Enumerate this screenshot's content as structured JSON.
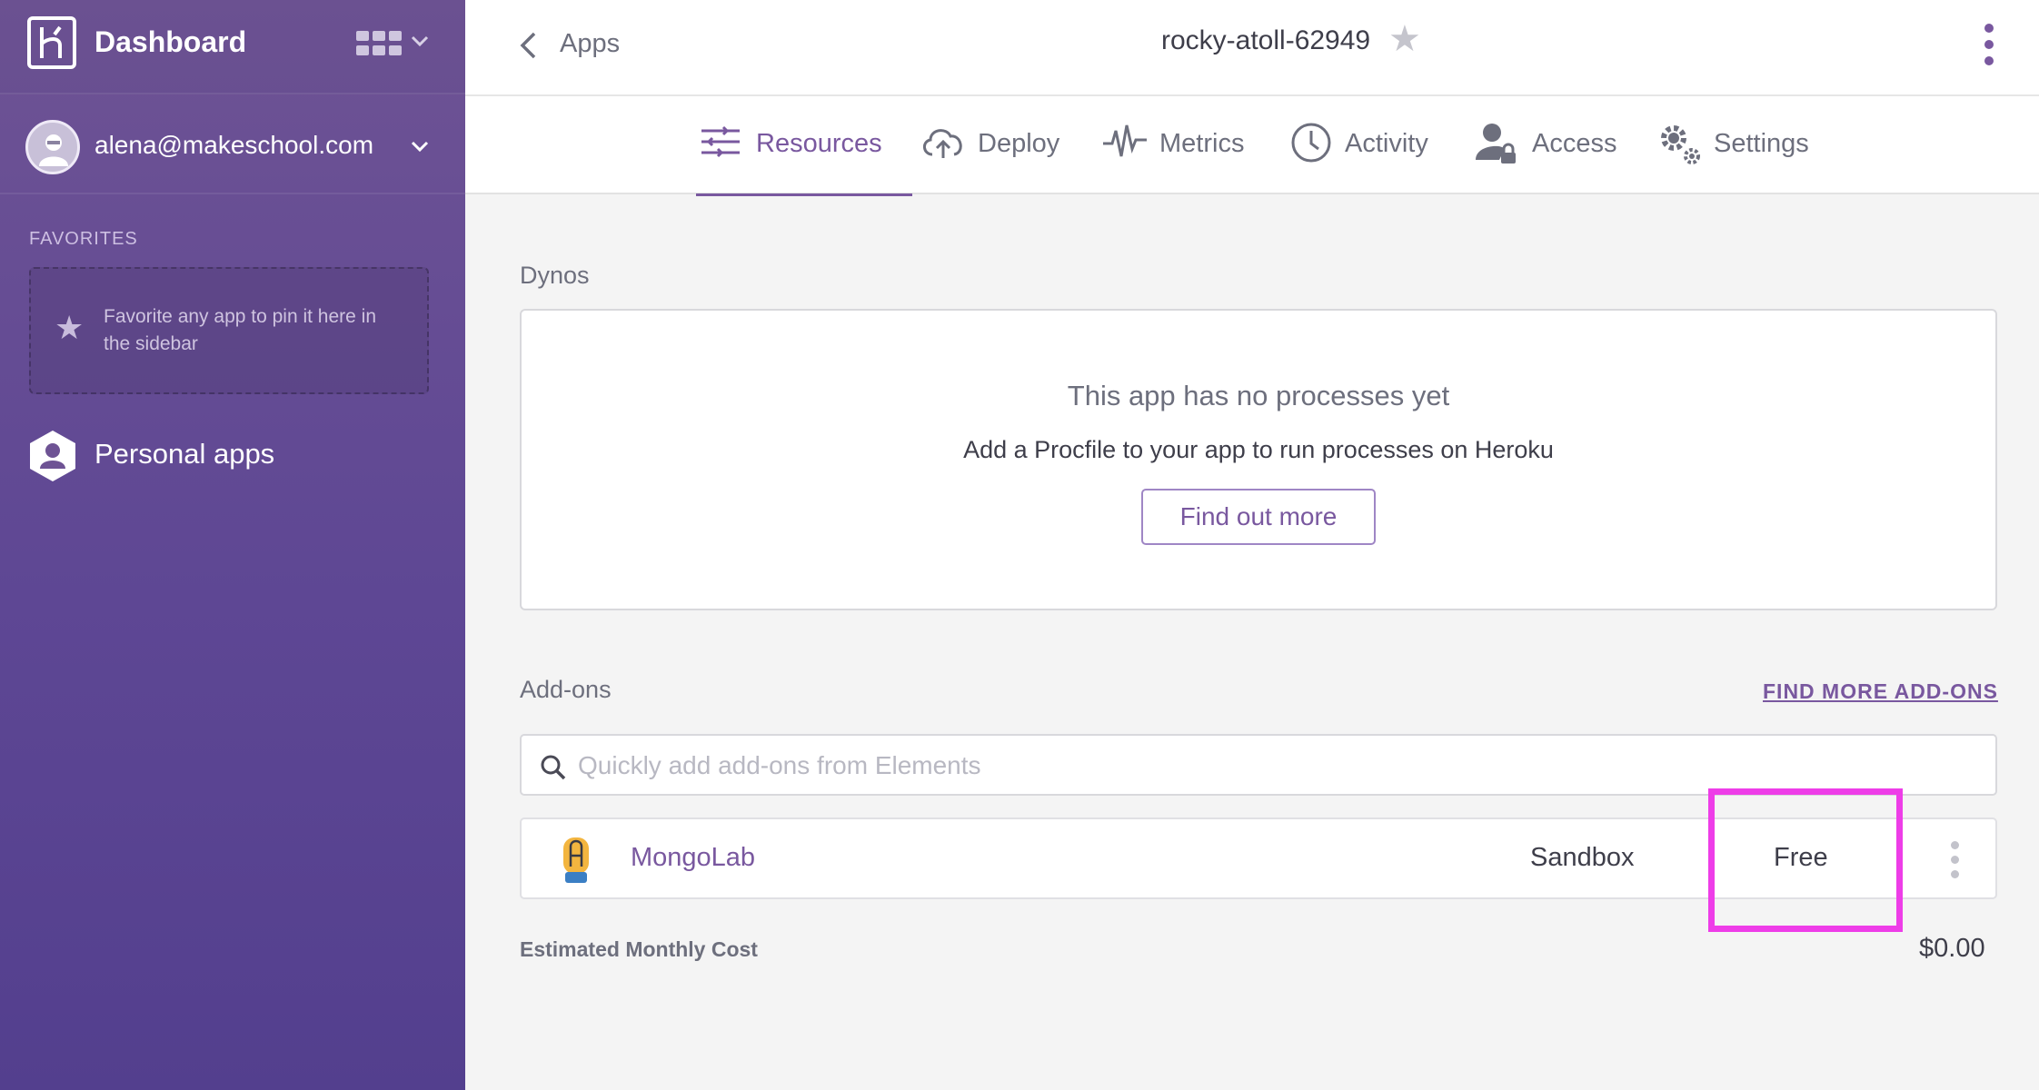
{
  "sidebar": {
    "title": "Dashboard",
    "account_email": "alena@makeschool.com",
    "favorites_label": "FAVORITES",
    "favorites_hint": "Favorite any app to pin it here in the sidebar",
    "personal_apps_label": "Personal apps"
  },
  "header": {
    "back_label": "Apps",
    "app_name": "rocky-atoll-62949"
  },
  "tabs": [
    {
      "label": "Resources",
      "icon": "resources-icon",
      "active": true
    },
    {
      "label": "Deploy",
      "icon": "cloud-upload-icon",
      "active": false
    },
    {
      "label": "Metrics",
      "icon": "pulse-icon",
      "active": false
    },
    {
      "label": "Activity",
      "icon": "clock-icon",
      "active": false
    },
    {
      "label": "Access",
      "icon": "user-lock-icon",
      "active": false
    },
    {
      "label": "Settings",
      "icon": "gears-icon",
      "active": false
    }
  ],
  "dynos": {
    "section_title": "Dynos",
    "empty_heading": "This app has no processes yet",
    "empty_text": "Add a Procfile to your app to run processes on Heroku",
    "button_label": "Find out more"
  },
  "addons": {
    "section_title": "Add-ons",
    "find_more_link": "FIND MORE ADD-ONS",
    "search_placeholder": "Quickly add add-ons from Elements",
    "items": [
      {
        "name": "MongoLab",
        "plan": "Sandbox",
        "price": "Free"
      }
    ],
    "estimated_cost_label": "Estimated Monthly Cost",
    "estimated_cost_value": "$0.00"
  },
  "colors": {
    "accent": "#79589f",
    "sidebar_bg": "#5e4794",
    "highlight": "#ee3de8"
  }
}
